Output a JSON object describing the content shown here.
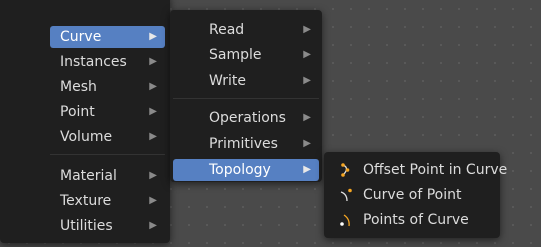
{
  "menu_main": {
    "items": [
      {
        "label": "Curve",
        "has_submenu": true,
        "active": true
      },
      {
        "label": "Instances",
        "has_submenu": true
      },
      {
        "label": "Mesh",
        "has_submenu": true
      },
      {
        "label": "Point",
        "has_submenu": true
      },
      {
        "label": "Volume",
        "has_submenu": true
      },
      {
        "label": "Material",
        "has_submenu": true
      },
      {
        "label": "Texture",
        "has_submenu": true
      },
      {
        "label": "Utilities",
        "has_submenu": true
      }
    ]
  },
  "menu_curve": {
    "items": [
      {
        "label": "Read",
        "has_submenu": true
      },
      {
        "label": "Sample",
        "has_submenu": true
      },
      {
        "label": "Write",
        "has_submenu": true
      },
      {
        "label": "Operations",
        "has_submenu": true
      },
      {
        "label": "Primitives",
        "has_submenu": true
      },
      {
        "label": "Topology",
        "has_submenu": true,
        "active": true
      }
    ]
  },
  "menu_topology": {
    "items": [
      {
        "label": "Offset Point in Curve",
        "icon": "offset-point-curve-icon"
      },
      {
        "label": "Curve of Point",
        "icon": "curve-of-point-icon"
      },
      {
        "label": "Points of Curve",
        "icon": "points-of-curve-icon"
      }
    ]
  },
  "colors": {
    "menu_bg": "#1f1f1f",
    "highlight": "#5680c2",
    "text": "#dcdcdc",
    "icon_accent": "#f5a623"
  },
  "submenu_arrow": "▶"
}
